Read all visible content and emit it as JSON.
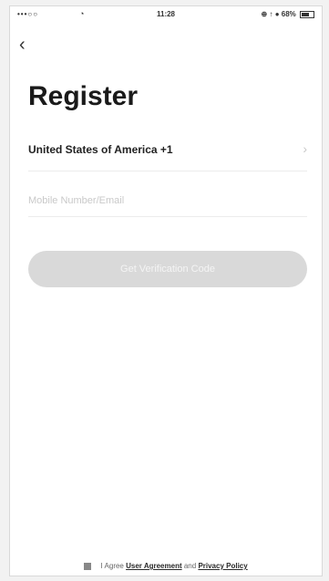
{
  "status_bar": {
    "signal": "•••○○",
    "wifi_icon": "wifi-icon",
    "time": "11:28",
    "right": "⊕ ↑ ● 68%"
  },
  "header": {
    "back_icon": "‹",
    "title": "Register"
  },
  "form": {
    "country": "United States of America +1",
    "country_chevron": "›",
    "mobile_placeholder": "Mobile Number/Email",
    "verify_button": "Get Verification Code"
  },
  "agreement": {
    "prefix": "I Agree ",
    "user_agreement": "User Agreement",
    "and": " and ",
    "privacy_policy": "Privacy Policy"
  },
  "colors": {
    "button_disabled": "#d9d9d9",
    "title": "#1a1a1a"
  }
}
